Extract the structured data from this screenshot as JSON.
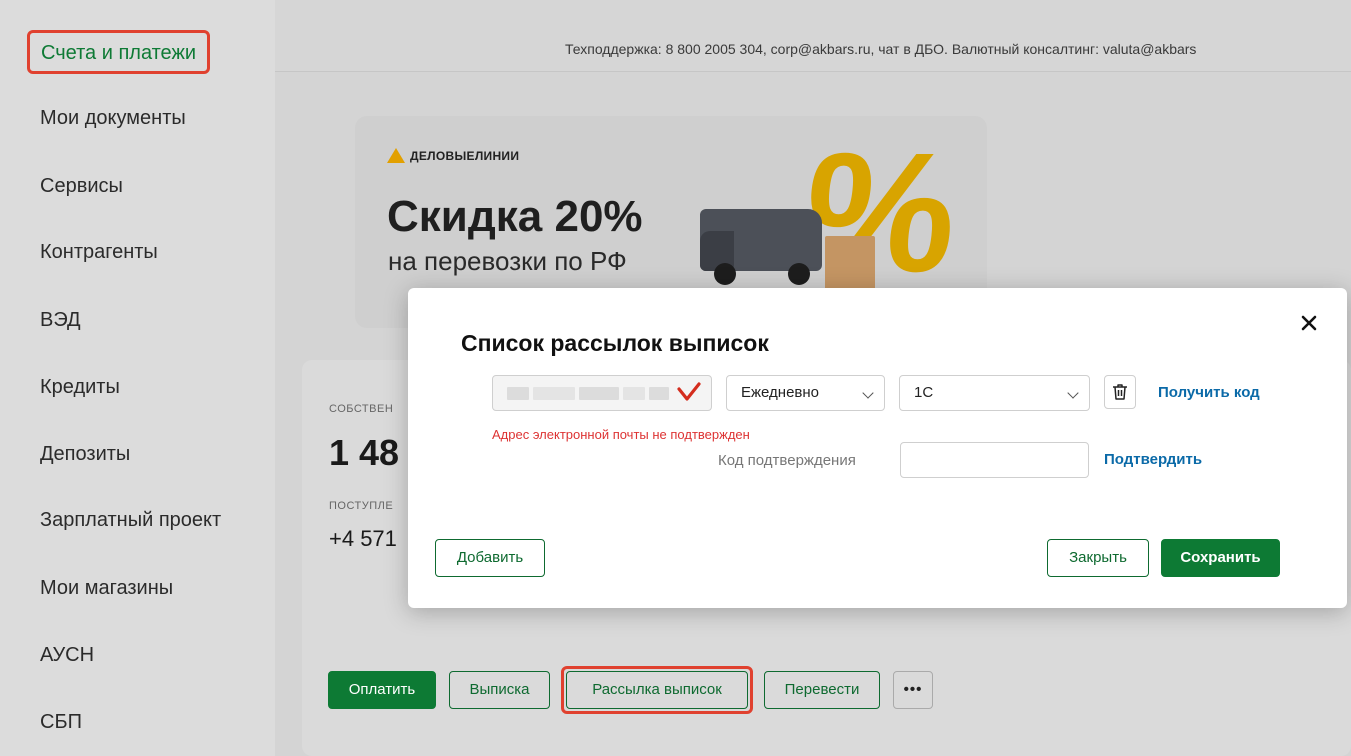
{
  "sidebar": {
    "items": [
      {
        "label": "Счета и платежи"
      },
      {
        "label": "Мои документы"
      },
      {
        "label": "Сервисы"
      },
      {
        "label": "Контрагенты"
      },
      {
        "label": "ВЭД"
      },
      {
        "label": "Кредиты"
      },
      {
        "label": "Депозиты"
      },
      {
        "label": "Зарплатный проект"
      },
      {
        "label": "Мои магазины"
      },
      {
        "label": "АУСН"
      },
      {
        "label": "СБП"
      }
    ]
  },
  "header": {
    "support_text": "Техподдержка: 8 800 2005 304, corp@akbars.ru, чат в ДБО. Валютный консалтинг: valuta@akbars"
  },
  "banner": {
    "brand": "ДЕЛОВЫЕЛИНИИ",
    "title": "Скидка 20%",
    "subtitle": "на перевозки по РФ",
    "percent_glyph": "%"
  },
  "account_card": {
    "own_label": "СОБСТВЕН",
    "balance": "1 48",
    "incoming_label": "ПОСТУПЛЕ",
    "incoming_value": "+4 571",
    "actions": {
      "pay": "Оплатить",
      "statement": "Выписка",
      "mailing": "Рассылка выписок",
      "transfer": "Перевести",
      "more": "•••"
    }
  },
  "modal": {
    "title": "Список рассылок выписок",
    "frequency": "Ежедневно",
    "format": "1С",
    "get_code": "Получить код",
    "error": "Адрес электронной почты не подтвержден",
    "code_label": "Код подтверждения",
    "code_value": "",
    "confirm": "Подтвердить",
    "add": "Добавить",
    "close": "Закрыть",
    "save": "Сохранить",
    "close_icon": "×"
  },
  "colors": {
    "accent_green": "#0d7a34",
    "highlight_red": "#e0412f",
    "link_blue": "#0b6aa8",
    "error_red": "#d33333",
    "banner_gold": "#d8a400"
  },
  "icons": [
    "close-icon",
    "trash-icon",
    "chevron-down-icon",
    "checkmark-icon",
    "more-icon",
    "logo-triangle-icon"
  ]
}
